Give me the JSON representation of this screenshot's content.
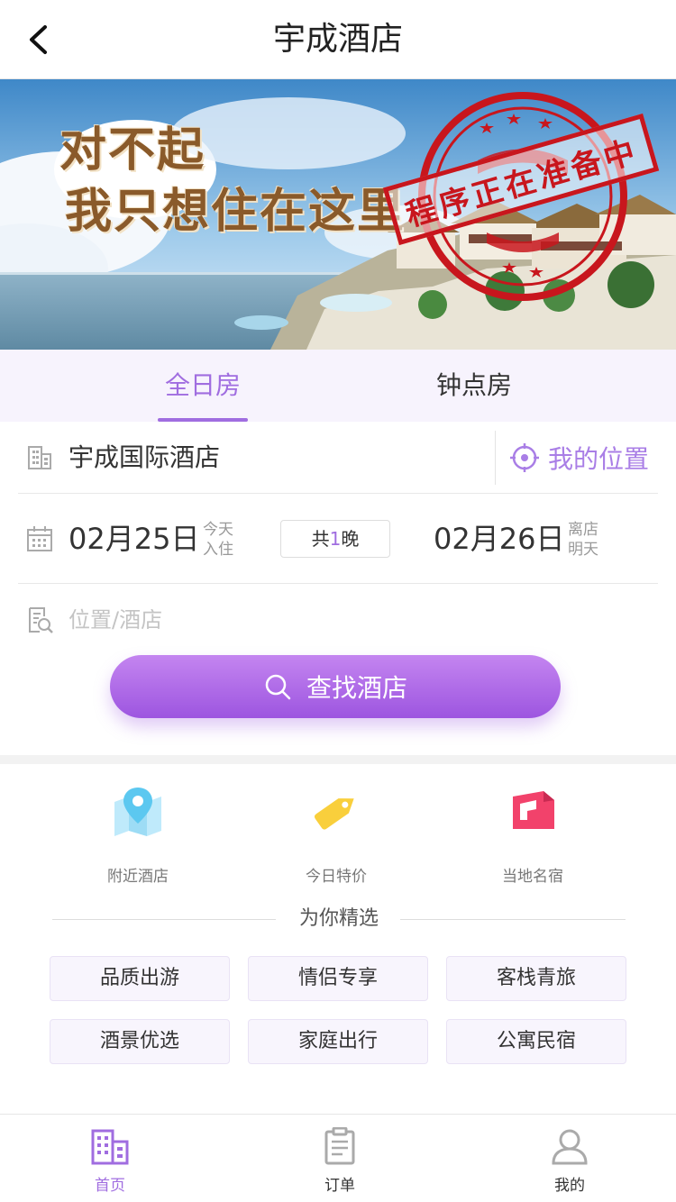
{
  "header": {
    "title": "宇成酒店"
  },
  "banner": {
    "line1": "对不起",
    "line2": "我只想住在这里",
    "stamp_text": "程序正在准备中"
  },
  "tabs": [
    {
      "label": "全日房",
      "active": true
    },
    {
      "label": "钟点房",
      "active": false
    }
  ],
  "search": {
    "hotel_name": "宇成国际酒店",
    "my_location": "我的位置",
    "checkin_date": "02月25日",
    "checkin_note_1": "今天",
    "checkin_note_2": "入住",
    "nights_prefix": "共",
    "nights_count": "1",
    "nights_suffix": "晚",
    "checkout_date": "02月26日",
    "checkout_note_1": "离店",
    "checkout_note_2": "明天",
    "keyword_placeholder": "位置/酒店",
    "search_button": "查找酒店"
  },
  "quick_entries": [
    {
      "label": "附近酒店",
      "icon": "map-pin-icon",
      "color": "#7fd6f5"
    },
    {
      "label": "今日特价",
      "icon": "price-tag-icon",
      "color": "#f9cf3c"
    },
    {
      "label": "当地名宿",
      "icon": "homestay-icon",
      "color": "#f2426b"
    }
  ],
  "picks": {
    "title": "为你精选",
    "items": [
      "品质出游",
      "情侣专享",
      "客栈青旅",
      "酒景优选",
      "家庭出行",
      "公寓民宿"
    ]
  },
  "bottom_nav": [
    {
      "label": "首页",
      "icon": "building-icon",
      "active": true
    },
    {
      "label": "订单",
      "icon": "clipboard-icon",
      "active": false
    },
    {
      "label": "我的",
      "icon": "user-icon",
      "active": false
    }
  ],
  "colors": {
    "accent": "#a06de0",
    "button_gradient_top": "#c485f0",
    "button_gradient_bottom": "#9d55e0",
    "stamp_red": "#c8161d"
  }
}
